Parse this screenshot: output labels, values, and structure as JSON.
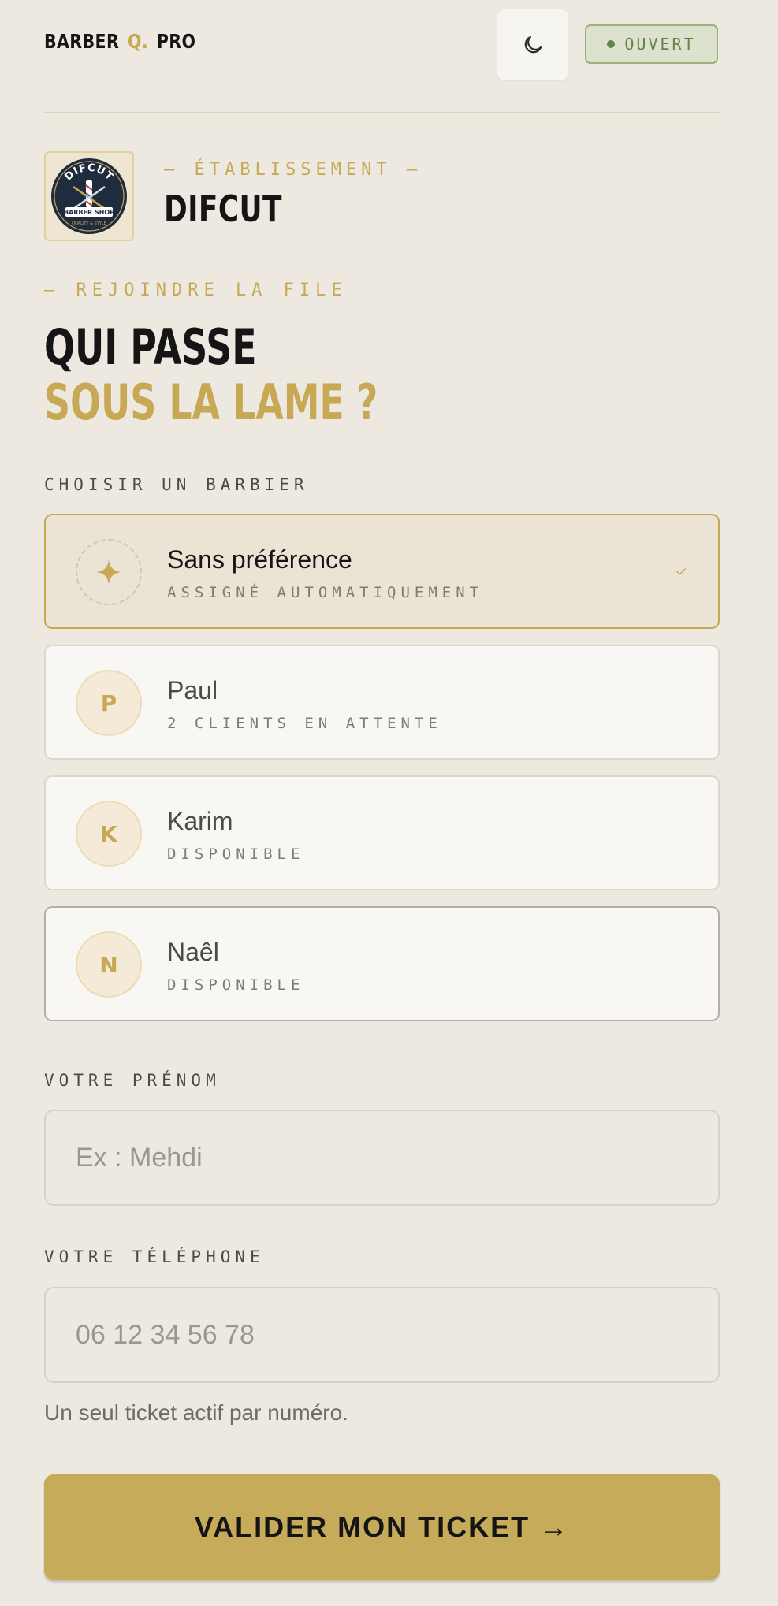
{
  "header": {
    "brand_left": "BARBER",
    "brand_mid": "Q.",
    "brand_right": "PRO",
    "theme_icon": "moon-icon",
    "status_label": "OUVERT",
    "status_color": "#64824a"
  },
  "establishment": {
    "label": "— ÉTABLISSEMENT —",
    "name": "DIFCUT",
    "logo_text_top": "DIFCUT",
    "logo_text_banner": "BARBER SHOP",
    "logo_text_bottom": "QUALITY & STYLE"
  },
  "join": {
    "label": "— REJOINDRE LA FILE",
    "title_line1": "QUI PASSE",
    "title_line2": "SOUS LA LAME ?"
  },
  "barbers": {
    "section_label": "CHOISIR UN BARBIER",
    "items": [
      {
        "initial": "",
        "icon": "sparkle-icon",
        "name": "Sans préférence",
        "sub": "ASSIGNÉ AUTOMATIQUEMENT",
        "selected": true
      },
      {
        "initial": "P",
        "name": "Paul",
        "sub": "2 CLIENTS EN ATTENTE",
        "selected": false
      },
      {
        "initial": "K",
        "name": "Karim",
        "sub": "DISPONIBLE",
        "selected": false
      },
      {
        "initial": "N",
        "name": "Naêl",
        "sub": "DISPONIBLE",
        "selected": false
      }
    ]
  },
  "form": {
    "firstname_label": "VOTRE PRÉNOM",
    "firstname_placeholder": "Ex : Mehdi",
    "phone_label": "VOTRE TÉLÉPHONE",
    "phone_placeholder": "06 12 34 56 78",
    "hint": "Un seul ticket actif par numéro.",
    "submit_label": "VALIDER MON TICKET →"
  },
  "colors": {
    "accent": "#c7a854",
    "background": "#eee9e0",
    "button": "#c6ab5b"
  }
}
